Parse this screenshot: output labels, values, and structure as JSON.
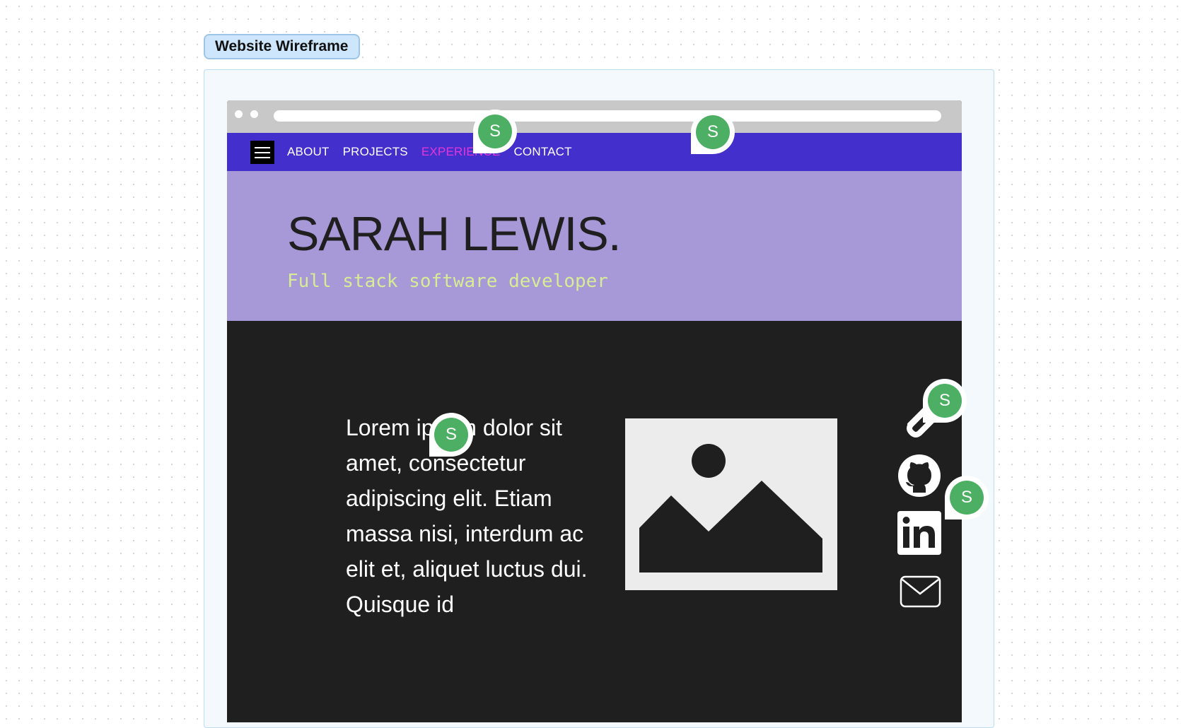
{
  "frame": {
    "label": "Website Wireframe"
  },
  "nav": {
    "links": [
      {
        "label": "ABOUT",
        "active": false
      },
      {
        "label": "PROJECTS",
        "active": false
      },
      {
        "label": "EXPERIENCE",
        "active": true
      },
      {
        "label": "CONTACT",
        "active": false
      }
    ]
  },
  "hero": {
    "name": "SARAH LEWIS.",
    "subtitle": "Full stack software developer"
  },
  "main": {
    "body": "Lorem ipsum dolor sit amet, consectetur adipiscing elit. Etiam massa nisi, interdum ac elit et, aliquet luctus dui. Quisque id"
  },
  "social_icons": [
    "link-icon",
    "github-icon",
    "linkedin-icon",
    "mail-icon"
  ],
  "collaborators": [
    {
      "initial": "S"
    },
    {
      "initial": "S"
    },
    {
      "initial": "S"
    },
    {
      "initial": "S"
    },
    {
      "initial": "S"
    }
  ],
  "colors": {
    "navbar": "#4330cc",
    "nav_active": "#e535d8",
    "hero_bg": "#a798d8",
    "hero_subtitle": "#d7ec94",
    "content_bg": "#1f1f1f",
    "avatar": "#4caf63"
  }
}
